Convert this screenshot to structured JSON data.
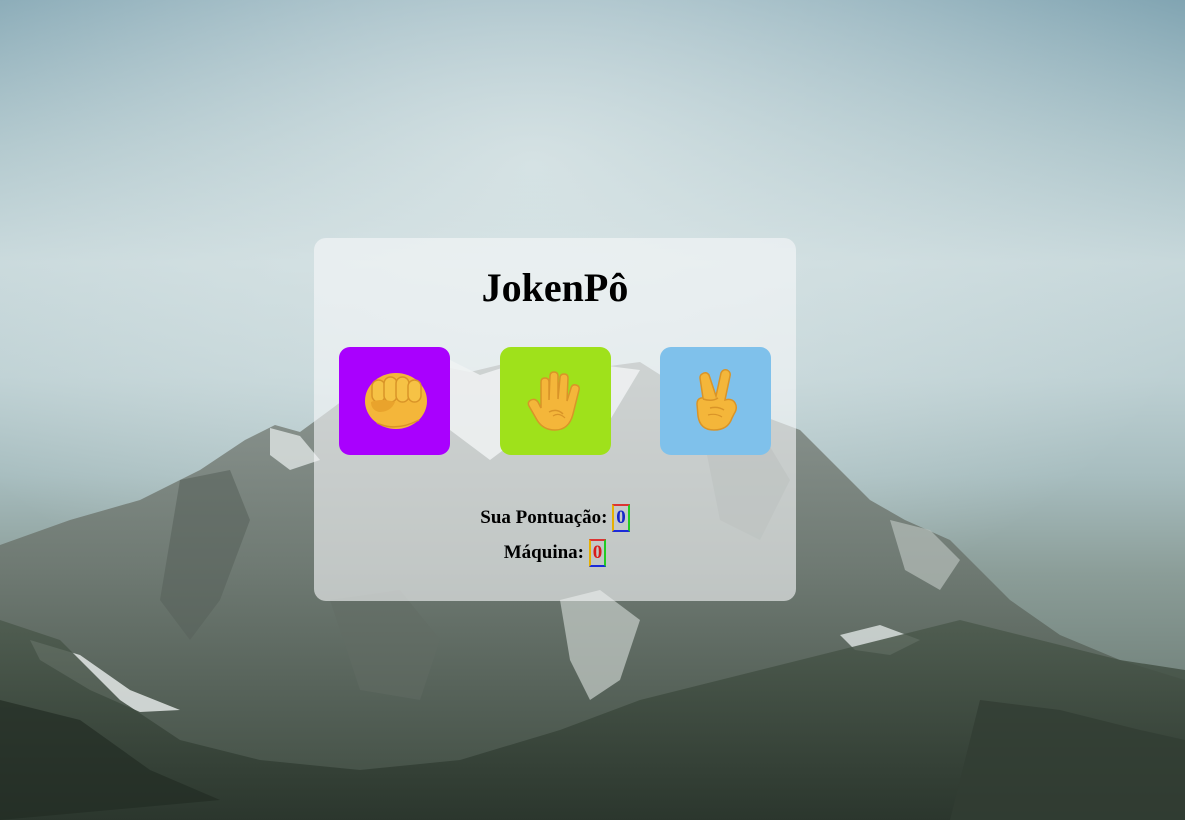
{
  "game": {
    "title": "JokenPô"
  },
  "choices": [
    {
      "name": "rock",
      "icon": "fist-icon",
      "color": "#a900fe"
    },
    {
      "name": "paper",
      "icon": "open-hand-icon",
      "color": "#9fe11b"
    },
    {
      "name": "scissors",
      "icon": "victory-hand-icon",
      "color": "#7fc1eb"
    }
  ],
  "score": {
    "user_label": "Sua Pontuação:",
    "user_value": "0",
    "user_value_color": "#1727c9",
    "machine_label": "Máquina:",
    "machine_value": "0",
    "machine_value_color": "#d81b1b"
  }
}
